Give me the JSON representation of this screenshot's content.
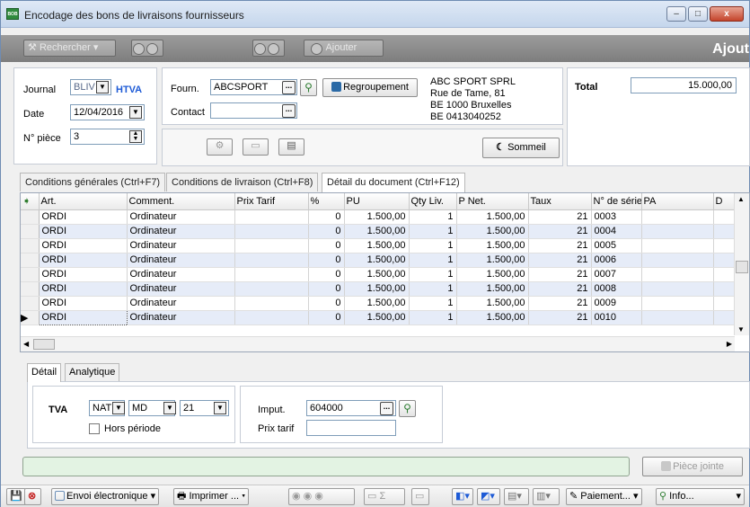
{
  "window": {
    "title": "Encodage des bons de livraisons fournisseurs",
    "minimize": "–",
    "maximize": "□",
    "close": "x"
  },
  "toolbar": {
    "search_label": "Rechercher",
    "add_label": "Ajouter",
    "mode_label": "Ajout"
  },
  "header": {
    "journal_label": "Journal",
    "journal_value": "BLIV",
    "journal_tag": "HTVA",
    "date_label": "Date",
    "date_value": "12/04/2016",
    "piece_label": "N° pièce",
    "piece_value": "3",
    "supplier_label": "Fourn.",
    "supplier_value": "ABCSPORT",
    "contact_label": "Contact",
    "contact_value": "",
    "group_button": "Regroupement",
    "address": [
      "ABC SPORT SPRL",
      "Rue de Tame, 81",
      "BE 1000 Bruxelles",
      "BE 0413040252"
    ],
    "sleep_button": "Sommeil",
    "total_label": "Total",
    "total_value": "15.000,00"
  },
  "tabs": [
    {
      "label": "Conditions générales (Ctrl+F7)"
    },
    {
      "label": "Conditions de livraison (Ctrl+F8)"
    },
    {
      "label": "Détail du document (Ctrl+F12)"
    }
  ],
  "grid": {
    "columns": [
      "Art.",
      "Comment.",
      "Prix Tarif",
      "%",
      "PU",
      "Qty Liv.",
      "P Net.",
      "Taux",
      "N° de série",
      "PA",
      "D"
    ],
    "rows": [
      [
        "ORDI",
        "Ordinateur",
        "",
        "0",
        "1.500,00",
        "1",
        "1.500,00",
        "21",
        "0003"
      ],
      [
        "ORDI",
        "Ordinateur",
        "",
        "0",
        "1.500,00",
        "1",
        "1.500,00",
        "21",
        "0004"
      ],
      [
        "ORDI",
        "Ordinateur",
        "",
        "0",
        "1.500,00",
        "1",
        "1.500,00",
        "21",
        "0005"
      ],
      [
        "ORDI",
        "Ordinateur",
        "",
        "0",
        "1.500,00",
        "1",
        "1.500,00",
        "21",
        "0006"
      ],
      [
        "ORDI",
        "Ordinateur",
        "",
        "0",
        "1.500,00",
        "1",
        "1.500,00",
        "21",
        "0007"
      ],
      [
        "ORDI",
        "Ordinateur",
        "",
        "0",
        "1.500,00",
        "1",
        "1.500,00",
        "21",
        "0008"
      ],
      [
        "ORDI",
        "Ordinateur",
        "",
        "0",
        "1.500,00",
        "1",
        "1.500,00",
        "21",
        "0009"
      ],
      [
        "ORDI",
        "Ordinateur",
        "",
        "0",
        "1.500,00",
        "1",
        "1.500,00",
        "21",
        "0010"
      ]
    ]
  },
  "detail": {
    "tabs": [
      "Détail",
      "Analytique"
    ],
    "tva_label": "TVA",
    "tva_code": "NAT",
    "tva_type": "MD",
    "tva_rate": "21",
    "hors_periode": "Hors période",
    "imput_label": "Imput.",
    "imput_value": "604000",
    "prix_tarif_label": "Prix tarif",
    "prix_tarif_value": ""
  },
  "attachment_button": "Pièce jointe",
  "bottom": {
    "send": "Envoi électronique",
    "print": "Imprimer ...",
    "payment": "Paiement...",
    "info": "Info..."
  }
}
